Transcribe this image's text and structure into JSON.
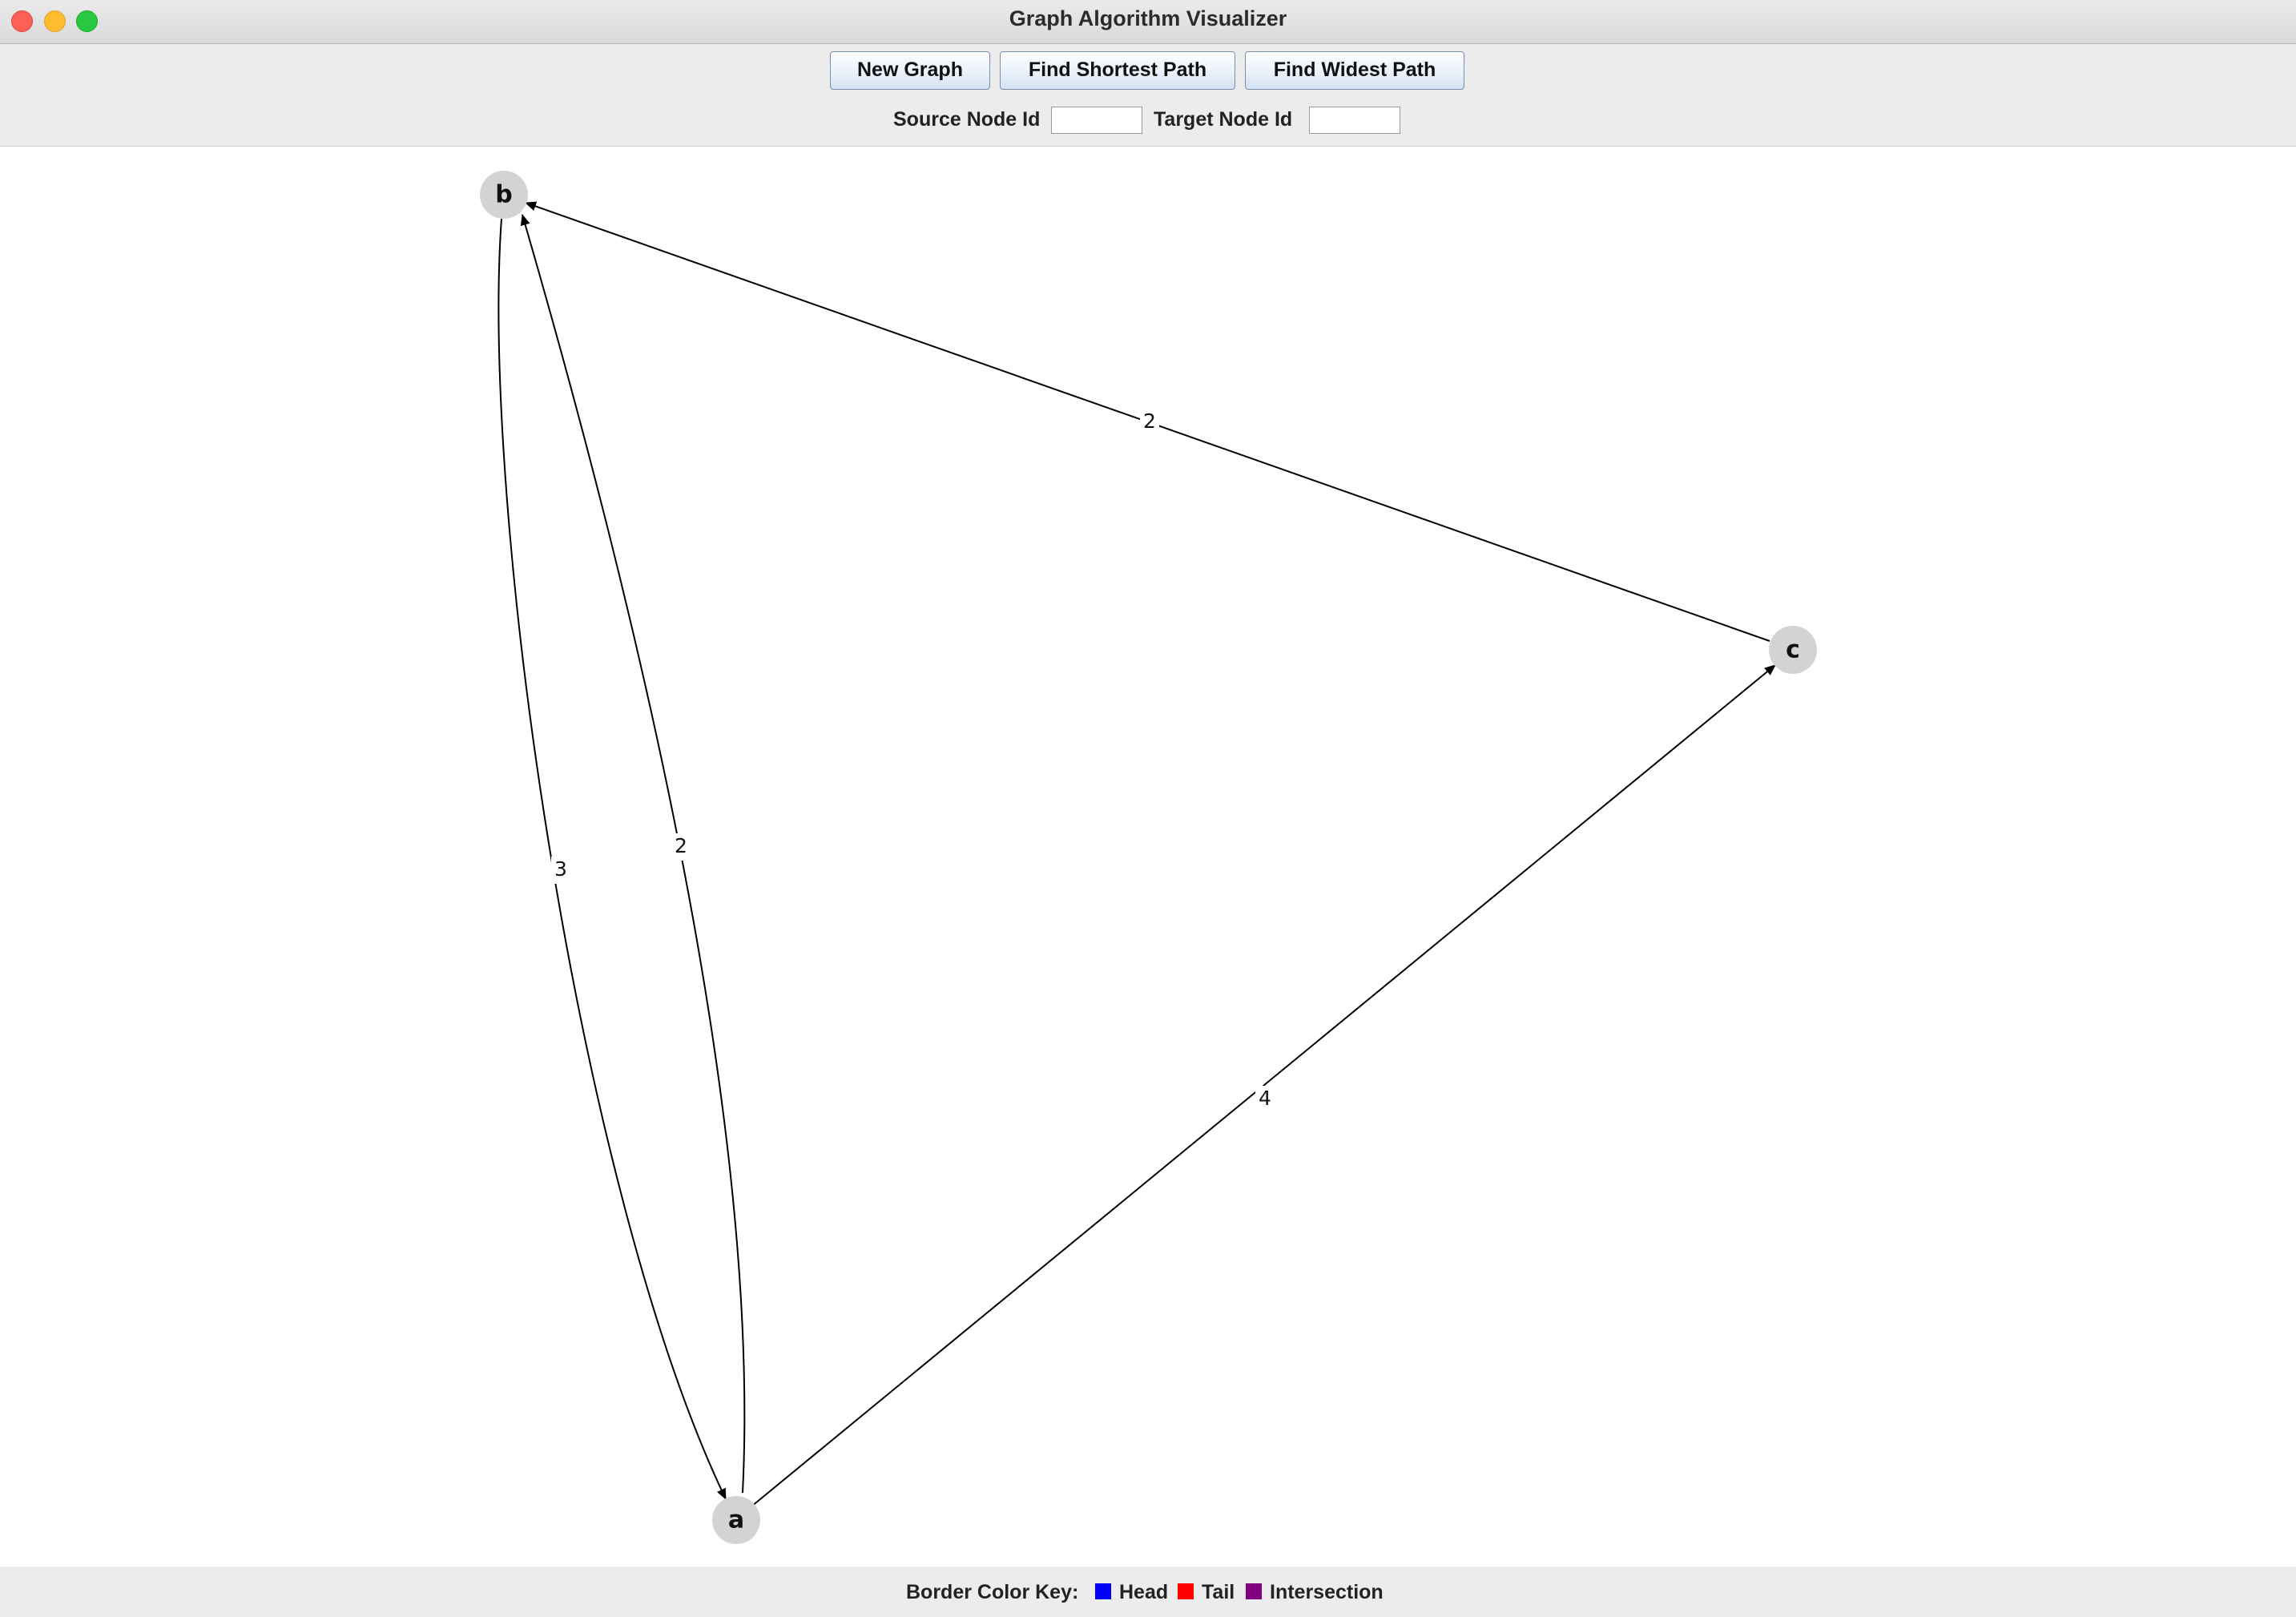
{
  "window": {
    "title": "Graph Algorithm Visualizer"
  },
  "toolbar": {
    "new_graph_label": "New Graph",
    "shortest_path_label": "Find Shortest Path",
    "widest_path_label": "Find Widest Path",
    "source_label": "Source Node Id",
    "source_value": "",
    "target_label": "Target Node Id",
    "target_value": ""
  },
  "graph": {
    "node_fill": "#d3d3d3",
    "edge_color": "#000000",
    "nodes": [
      {
        "id": "a"
      },
      {
        "id": "b"
      },
      {
        "id": "c"
      }
    ],
    "edges": [
      {
        "from": "b",
        "to": "a",
        "weight": "3"
      },
      {
        "from": "a",
        "to": "b",
        "weight": "2"
      },
      {
        "from": "c",
        "to": "b",
        "weight": "2"
      },
      {
        "from": "a",
        "to": "c",
        "weight": "4"
      }
    ]
  },
  "legend": {
    "title": "Border Color Key:",
    "items": [
      {
        "label": "Head",
        "color": "#0000ff"
      },
      {
        "label": "Tail",
        "color": "#ff0000"
      },
      {
        "label": "Intersection",
        "color": "#800080"
      }
    ]
  }
}
